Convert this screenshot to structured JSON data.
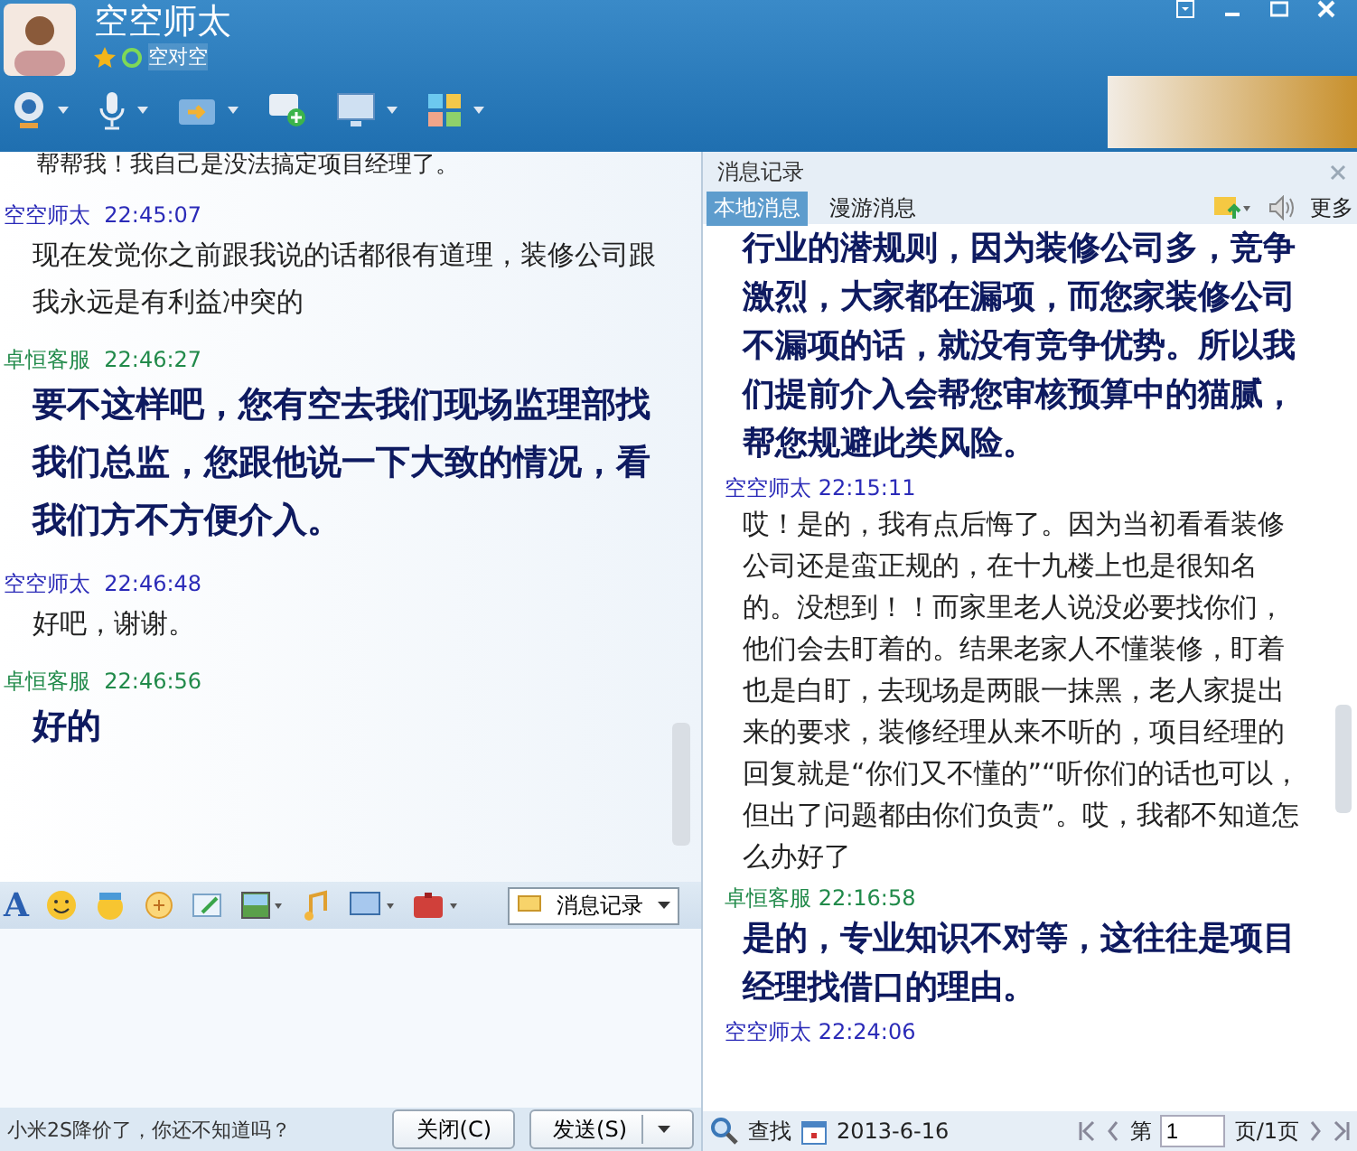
{
  "window": {
    "title": "空空师太",
    "subtitle": "空对空"
  },
  "toolbar": {
    "tools": [
      {
        "kind": "camera",
        "dropdown": true
      },
      {
        "kind": "microphone",
        "dropdown": true
      },
      {
        "kind": "folder",
        "dropdown": true
      },
      {
        "kind": "chat",
        "dropdown": false
      },
      {
        "kind": "monitor",
        "dropdown": true
      },
      {
        "kind": "apps",
        "dropdown": true
      }
    ]
  },
  "chat": {
    "partial_line": "帮帮我！我自己是没法搞定项目经理了。",
    "messages": [
      {
        "sender": "空空师太",
        "time": "22:45:07",
        "color": "#2b2bb8",
        "emphasis": false,
        "text": "现在发觉你之前跟我说的话都很有道理，装修公司跟我永远是有利益冲突的"
      },
      {
        "sender": "卓恒客服",
        "time": "22:46:27",
        "color": "#218a4a",
        "emphasis": true,
        "text": "要不这样吧，您有空去我们现场监理部找我们总监，您跟他说一下大致的情况，看我们方不方便介入。"
      },
      {
        "sender": "空空师太",
        "time": "22:46:48",
        "color": "#2b2bb8",
        "emphasis": false,
        "text": "好吧，谢谢。"
      },
      {
        "sender": "卓恒客服",
        "time": "22:46:56",
        "color": "#218a4a",
        "emphasis": true,
        "text": "好的"
      }
    ]
  },
  "compose_toolbar": {
    "font_label": "A",
    "history_button": "消息记录"
  },
  "bottom_bar": {
    "ad_text": "小米2S降价了，你还不知道吗？",
    "close_button": "关闭(C)",
    "send_button": "发送(S)"
  },
  "history": {
    "title": "消息记录",
    "tabs": [
      {
        "label": "本地消息",
        "selected": true
      },
      {
        "label": "漫游消息",
        "selected": false
      }
    ],
    "more_label": "更多",
    "messages": [
      {
        "emphasis": true,
        "text": "行业的潜规则，因为装修公司多，竞争激烈，大家都在漏项，而您家装修公司不漏项的话，就没有竞争优势。所以我们提前介入会帮您审核预算中的猫腻，帮您规避此类风险。"
      },
      {
        "sender": "空空师太",
        "time": "22:15:11",
        "color": "#2b2bb8",
        "emphasis": false,
        "text": "哎！是的，我有点后悔了。因为当初看看装修公司还是蛮正规的，在十九楼上也是很知名的。没想到！！而家里老人说没必要找你们，他们会去盯着的。结果老家人不懂装修，盯着也是白盯，去现场是两眼一抹黑，老人家提出来的要求，装修经理从来不听的，项目经理的回复就是“你们又不懂的”“听你们的话也可以，但出了问题都由你们负责”。哎，我都不知道怎么办好了"
      },
      {
        "sender": "卓恒客服",
        "time": "22:16:58",
        "color": "#218a4a",
        "emphasis": true,
        "text": "是的，专业知识不对等，这往往是项目经理找借口的理由。"
      },
      {
        "sender": "空空师太",
        "time": "22:24:06",
        "color": "#2b2bb8"
      }
    ],
    "search_label": "查找",
    "date": "2013-6-16",
    "page_prefix": "第",
    "page_value": "1",
    "page_suffix": "页/1页"
  }
}
